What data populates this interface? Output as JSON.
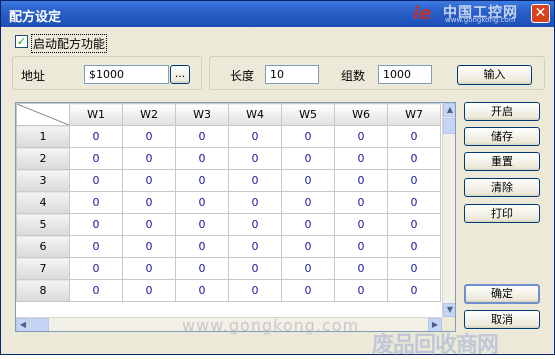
{
  "window": {
    "title": "配方设定"
  },
  "logo": {
    "mark": "ie",
    "name": "中国工控网",
    "url": "www.gongkong.com"
  },
  "recipe": {
    "enable_label": "启动配方功能",
    "enabled": true
  },
  "address": {
    "label": "地址",
    "value": "$1000",
    "browse_label": "..."
  },
  "params": {
    "length_label": "长度",
    "length_value": "10",
    "groups_label": "组数",
    "groups_value": "1000",
    "input_label": "输入"
  },
  "grid": {
    "columns": [
      "W1",
      "W2",
      "W3",
      "W4",
      "W5",
      "W6",
      "W7"
    ],
    "rows": [
      {
        "label": "1",
        "values": [
          "0",
          "0",
          "0",
          "0",
          "0",
          "0",
          "0"
        ]
      },
      {
        "label": "2",
        "values": [
          "0",
          "0",
          "0",
          "0",
          "0",
          "0",
          "0"
        ]
      },
      {
        "label": "3",
        "values": [
          "0",
          "0",
          "0",
          "0",
          "0",
          "0",
          "0"
        ]
      },
      {
        "label": "4",
        "values": [
          "0",
          "0",
          "0",
          "0",
          "0",
          "0",
          "0"
        ]
      },
      {
        "label": "5",
        "values": [
          "0",
          "0",
          "0",
          "0",
          "0",
          "0",
          "0"
        ]
      },
      {
        "label": "6",
        "values": [
          "0",
          "0",
          "0",
          "0",
          "0",
          "0",
          "0"
        ]
      },
      {
        "label": "7",
        "values": [
          "0",
          "0",
          "0",
          "0",
          "0",
          "0",
          "0"
        ]
      },
      {
        "label": "8",
        "values": [
          "0",
          "0",
          "0",
          "0",
          "0",
          "0",
          "0"
        ]
      }
    ]
  },
  "side_buttons": {
    "open": "开启",
    "save": "储存",
    "reset": "重置",
    "clear": "清除",
    "print": "打印"
  },
  "footer": {
    "ok": "确定",
    "cancel": "取消"
  },
  "watermark": {
    "text": "www.gongkong.com",
    "text2": "废品回收商网"
  }
}
